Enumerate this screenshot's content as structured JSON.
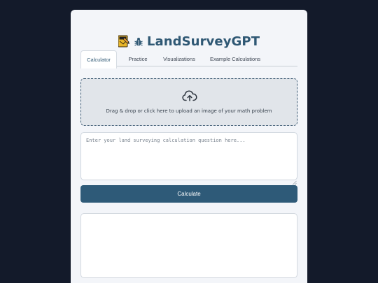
{
  "app": {
    "title": "LandSurveyGPT",
    "logo_icon": "map-pencil-icon",
    "title_icon": "bug-icon"
  },
  "tabs": [
    {
      "label": "Calculator",
      "active": true
    },
    {
      "label": "Practice",
      "active": false
    },
    {
      "label": "Visualizations",
      "active": false
    },
    {
      "label": "Example Calculations",
      "active": false
    }
  ],
  "upload": {
    "icon": "cloud-upload-icon",
    "text": "Drag & drop or click here to upload an image of your math problem"
  },
  "question": {
    "placeholder": "Enter your land surveying calculation question here...",
    "value": ""
  },
  "calculate": {
    "label": "Calculate"
  },
  "colors": {
    "page_background": "#131a2a",
    "card_background": "#f3f5f9",
    "accent": "#2e5a78",
    "title": "#2f5874"
  }
}
